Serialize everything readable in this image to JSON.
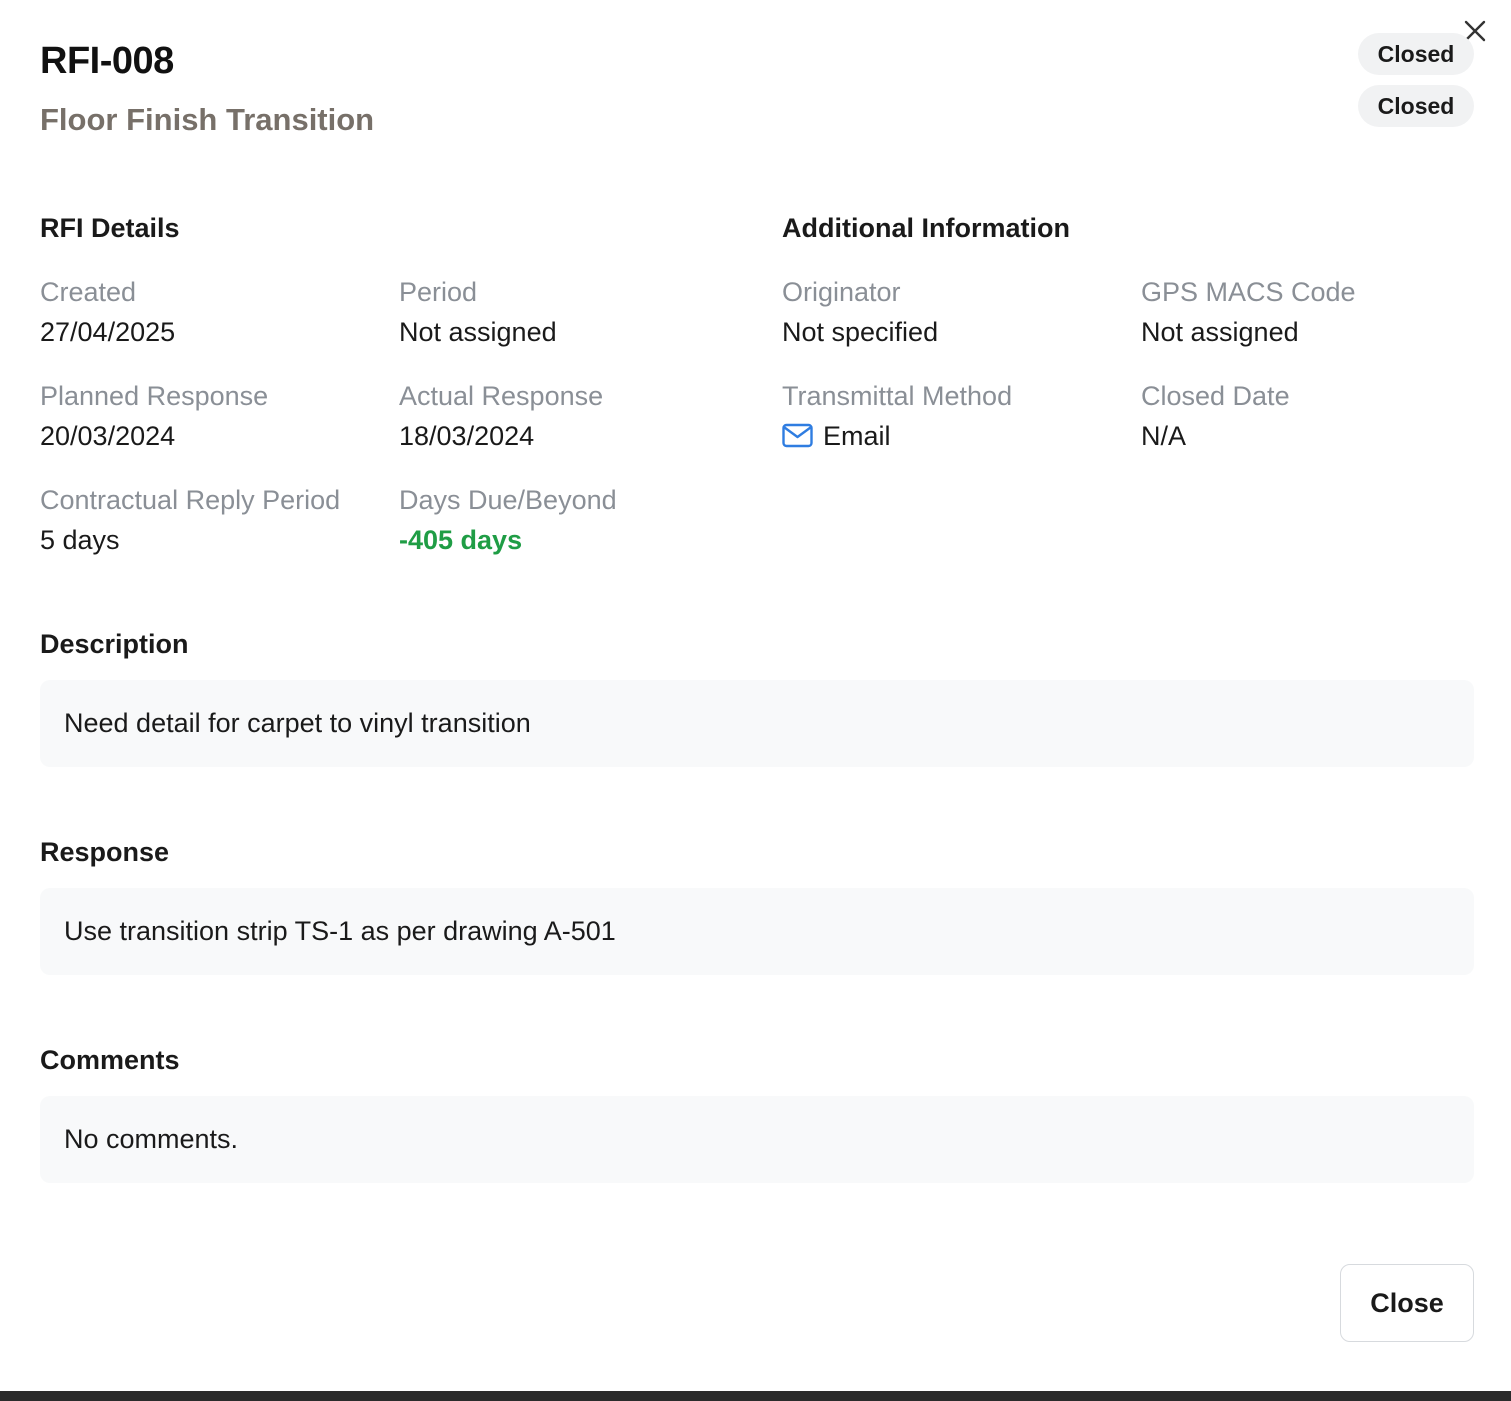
{
  "header": {
    "title": "RFI-008",
    "subtitle": "Floor Finish Transition",
    "badges": [
      "Closed",
      "Closed"
    ]
  },
  "rfi_details": {
    "heading": "RFI Details",
    "fields": [
      {
        "label": "Created",
        "value": "27/04/2025"
      },
      {
        "label": "Period",
        "value": "Not assigned"
      },
      {
        "label": "Planned Response",
        "value": "20/03/2024"
      },
      {
        "label": "Actual Response",
        "value": "18/03/2024"
      },
      {
        "label": "Contractual Reply Period",
        "value": "5 days"
      },
      {
        "label": "Days Due/Beyond",
        "value": "-405 days"
      }
    ]
  },
  "additional_info": {
    "heading": "Additional Information",
    "fields": [
      {
        "label": "Originator",
        "value": "Not specified"
      },
      {
        "label": "GPS MACS Code",
        "value": "Not assigned"
      },
      {
        "label": "Transmittal Method",
        "value": "Email",
        "icon": "mail-icon"
      },
      {
        "label": "Closed Date",
        "value": "N/A"
      }
    ]
  },
  "description": {
    "heading": "Description",
    "text": "Need detail for carpet to vinyl transition"
  },
  "response": {
    "heading": "Response",
    "text": "Use transition strip TS-1 as per drawing A-501"
  },
  "comments": {
    "heading": "Comments",
    "text": "No comments."
  },
  "footer": {
    "close_label": "Close"
  },
  "colors": {
    "days_due": "#1f9d45",
    "mail_icon": "#2f7de1",
    "badge_bg": "#f1f2f3",
    "panel_bg": "#f8f9fa"
  }
}
